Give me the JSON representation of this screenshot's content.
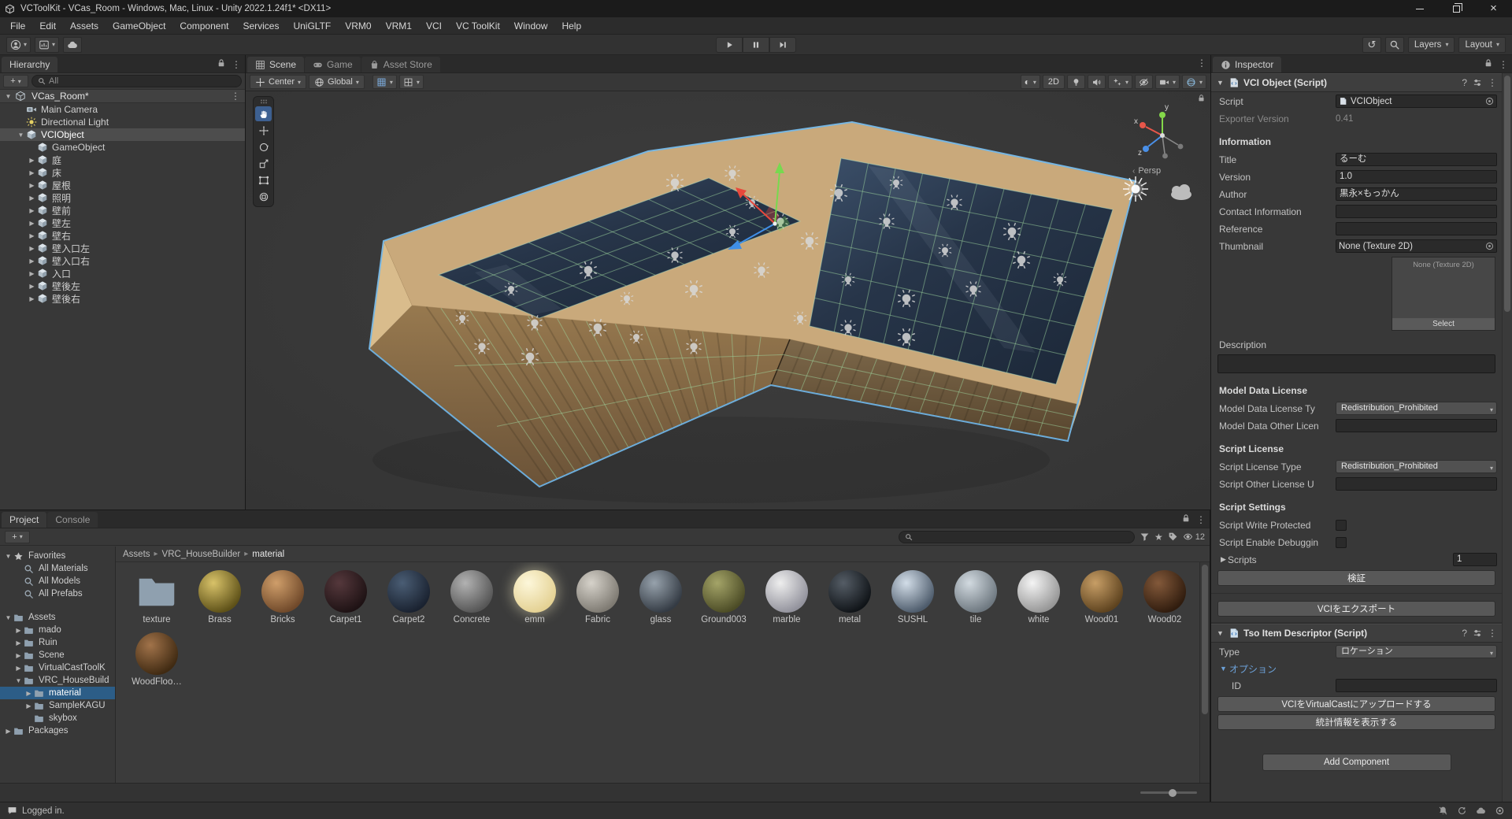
{
  "window": {
    "title": "VCToolKit - VCas_Room - Windows, Mac, Linux - Unity 2022.1.24f1* <DX11>"
  },
  "menubar": {
    "items": [
      "File",
      "Edit",
      "Assets",
      "GameObject",
      "Component",
      "Services",
      "UniGLTF",
      "VRM0",
      "VRM1",
      "VCI",
      "VC ToolKit",
      "Window",
      "Help"
    ]
  },
  "toolbar": {
    "layers": "Layers",
    "layout": "Layout"
  },
  "statusbar": {
    "message": "Logged in."
  },
  "hierarchy": {
    "tab": "Hierarchy",
    "search_value": "All",
    "scene_row": "VCas_Room*",
    "items": [
      {
        "label": "Main Camera",
        "depth": 1,
        "icon": "camera",
        "arrow": ""
      },
      {
        "label": "Directional Light",
        "depth": 1,
        "icon": "light",
        "arrow": ""
      },
      {
        "label": "VCIObject",
        "depth": 1,
        "icon": "cube",
        "arrow": "expanded",
        "selected": true
      },
      {
        "label": "GameObject",
        "depth": 2,
        "icon": "cube",
        "arrow": ""
      },
      {
        "label": "庭",
        "depth": 2,
        "icon": "cube",
        "arrow": "collapsed"
      },
      {
        "label": "床",
        "depth": 2,
        "icon": "cube",
        "arrow": "collapsed"
      },
      {
        "label": "屋根",
        "depth": 2,
        "icon": "cube",
        "arrow": "collapsed"
      },
      {
        "label": "照明",
        "depth": 2,
        "icon": "cube",
        "arrow": "collapsed"
      },
      {
        "label": "壁前",
        "depth": 2,
        "icon": "cube",
        "arrow": "collapsed"
      },
      {
        "label": "壁左",
        "depth": 2,
        "icon": "cube",
        "arrow": "collapsed"
      },
      {
        "label": "壁右",
        "depth": 2,
        "icon": "cube",
        "arrow": "collapsed"
      },
      {
        "label": "壁入口左",
        "depth": 2,
        "icon": "cube",
        "arrow": "collapsed"
      },
      {
        "label": "壁入口右",
        "depth": 2,
        "icon": "cube",
        "arrow": "collapsed"
      },
      {
        "label": "入口",
        "depth": 2,
        "icon": "cube",
        "arrow": "collapsed"
      },
      {
        "label": "壁後左",
        "depth": 2,
        "icon": "cube",
        "arrow": "collapsed"
      },
      {
        "label": "壁後右",
        "depth": 2,
        "icon": "cube",
        "arrow": "collapsed"
      }
    ]
  },
  "scene": {
    "tabs": [
      "Scene",
      "Game",
      "Asset Store"
    ],
    "handle_position": "Center",
    "handle_rotation": "Global",
    "btn_2d": "2D",
    "projection": "Persp",
    "axis_x": "x",
    "axis_y": "y",
    "axis_z": "z"
  },
  "inspector": {
    "tab": "Inspector",
    "vci": {
      "header": "VCI Object (Script)",
      "script": {
        "label": "Script",
        "value": "VCIObject"
      },
      "exporter": {
        "label": "Exporter Version",
        "value": "0.41"
      },
      "info_header": "Information",
      "title": {
        "label": "Title",
        "value": "るーむ"
      },
      "version": {
        "label": "Version",
        "value": "1.0"
      },
      "author": {
        "label": "Author",
        "value": "黒永×もっかん"
      },
      "contact": {
        "label": "Contact Information",
        "value": ""
      },
      "reference": {
        "label": "Reference",
        "value": ""
      },
      "thumbnail": {
        "label": "Thumbnail",
        "value": "None (Texture 2D)",
        "preview_label": "None (Texture 2D)",
        "select": "Select"
      },
      "description": {
        "label": "Description",
        "value": ""
      },
      "model_header": "Model Data License",
      "model_type": {
        "label": "Model Data License Ty",
        "value": "Redistribution_Prohibited"
      },
      "model_other": {
        "label": "Model Data Other Licen",
        "value": ""
      },
      "script_license_header": "Script License",
      "sl_type": {
        "label": "Script License Type",
        "value": "Redistribution_Prohibited"
      },
      "sl_other": {
        "label": "Script Other License U",
        "value": ""
      },
      "settings_header": "Script Settings",
      "write_protected": {
        "label": "Script Write Protected",
        "checked": false
      },
      "enable_debug": {
        "label": "Script Enable Debuggin",
        "checked": false
      },
      "scripts": {
        "label": "Scripts",
        "value": "1"
      },
      "validate_btn": "検証",
      "export_btn": "VCIをエクスポート"
    },
    "tso": {
      "header": "Tso Item Descriptor (Script)",
      "type": {
        "label": "Type",
        "value": "ロケーション"
      },
      "options": "オプション",
      "id": {
        "label": "ID",
        "value": ""
      },
      "upload_btn": "VCIをVirtualCastにアップロードする",
      "stats_btn": "統計情報を表示する"
    },
    "add_component": "Add Component"
  },
  "project": {
    "tabs": [
      "Project",
      "Console"
    ],
    "hidden_count": "12",
    "breadcrumb": [
      "Assets",
      "VRC_HouseBuilder",
      "material"
    ],
    "tree": [
      {
        "label": "Favorites",
        "depth": 0,
        "icon": "star",
        "arrow": "expanded"
      },
      {
        "label": "All Materials",
        "depth": 1,
        "icon": "search",
        "arrow": ""
      },
      {
        "label": "All Models",
        "depth": 1,
        "icon": "search",
        "arrow": ""
      },
      {
        "label": "All Prefabs",
        "depth": 1,
        "icon": "search",
        "arrow": "",
        "gap_after": true
      },
      {
        "label": "Assets",
        "depth": 0,
        "icon": "folder",
        "arrow": "expanded"
      },
      {
        "label": "mado",
        "depth": 1,
        "icon": "folder",
        "arrow": "collapsed"
      },
      {
        "label": "Ruin",
        "depth": 1,
        "icon": "folder",
        "arrow": "collapsed"
      },
      {
        "label": "Scene",
        "depth": 1,
        "icon": "folder",
        "arrow": "collapsed"
      },
      {
        "label": "VirtualCastToolK",
        "depth": 1,
        "icon": "folder",
        "arrow": "collapsed"
      },
      {
        "label": "VRC_HouseBuild",
        "depth": 1,
        "icon": "folder",
        "arrow": "expanded"
      },
      {
        "label": "material",
        "depth": 2,
        "icon": "folder",
        "arrow": "collapsed",
        "selected": true
      },
      {
        "label": "SampleKAGU",
        "depth": 2,
        "icon": "folder",
        "arrow": "collapsed"
      },
      {
        "label": "skybox",
        "depth": 2,
        "icon": "folder",
        "arrow": ""
      },
      {
        "label": "Packages",
        "depth": 0,
        "icon": "folder",
        "arrow": "collapsed"
      }
    ],
    "items": [
      {
        "name": "texture",
        "kind": "folder"
      },
      {
        "name": "Brass",
        "c1": "#d8c269",
        "c2": "#5e5118"
      },
      {
        "name": "Bricks",
        "c1": "#cf9e6a",
        "c2": "#70492a"
      },
      {
        "name": "Carpet1",
        "c1": "#55383c",
        "c2": "#1e1214"
      },
      {
        "name": "Carpet2",
        "c1": "#4a5d74",
        "c2": "#1a2230"
      },
      {
        "name": "Concrete",
        "c1": "#b2b2b2",
        "c2": "#565656"
      },
      {
        "name": "emm",
        "c1": "#fdf7da",
        "c2": "#e4d193",
        "glow": true
      },
      {
        "name": "Fabric",
        "c1": "#d6d2ca",
        "c2": "#7e7a72"
      },
      {
        "name": "glass",
        "c1": "#97a2ac",
        "c2": "#343b44"
      },
      {
        "name": "Ground003",
        "c1": "#a4a468",
        "c2": "#4c4c26"
      },
      {
        "name": "marble",
        "c1": "#eeeeee",
        "c2": "#92929c"
      },
      {
        "name": "metal",
        "c1": "#555d66",
        "c2": "#101418"
      },
      {
        "name": "SUSHL",
        "c1": "#d2dde8",
        "c2": "#4e5c6c"
      },
      {
        "name": "tile",
        "c1": "#d2dae0",
        "c2": "#6e7880"
      },
      {
        "name": "white",
        "c1": "#f4f4f4",
        "c2": "#969696"
      },
      {
        "name": "Wood01",
        "c1": "#c79e66",
        "c2": "#5e431f"
      },
      {
        "name": "Wood02",
        "c1": "#83593a",
        "c2": "#301c0e"
      },
      {
        "name": "WoodFloo…",
        "c1": "#a1734a",
        "c2": "#402a12"
      }
    ]
  },
  "colors": {
    "selection_blue": "#2c5d87",
    "selection_gray": "#4d4d4d",
    "outline_blue": "#6fb5e8",
    "wire_green": "#9fd89f"
  }
}
